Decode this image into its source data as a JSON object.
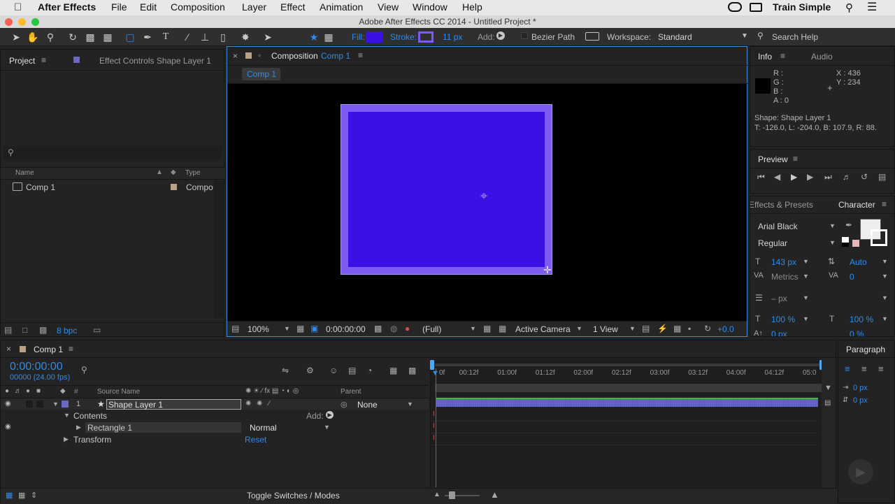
{
  "colors": {
    "accent": "#2d8ceb",
    "shape_fill": "#3a10e5",
    "shape_stroke": "#7d5cf3"
  },
  "menubar": {
    "apple": "",
    "app": "After Effects",
    "items": [
      "File",
      "Edit",
      "Composition",
      "Layer",
      "Effect",
      "Animation",
      "View",
      "Window",
      "Help"
    ],
    "right": "Train Simple"
  },
  "titlebar": {
    "title": "Adobe After Effects CC 2014 - Untitled Project *"
  },
  "toolbar": {
    "fill_label": "Fill:",
    "stroke_label": "Stroke:",
    "stroke_width": "11 px",
    "add_label": "Add:",
    "bezier_label": "Bezier Path",
    "workspace_label": "Workspace:",
    "workspace_value": "Standard",
    "search_placeholder": "Search Help"
  },
  "project": {
    "tab_project": "Project",
    "tab_effect_controls": "Effect Controls Shape Layer 1",
    "col_name": "Name",
    "col_type": "Type",
    "items": [
      {
        "name": "Comp 1",
        "type": "Compo"
      }
    ],
    "bpc": "8 bpc"
  },
  "composition": {
    "tab_prefix": "Composition",
    "tab_name": "Comp 1",
    "breadcrumb": "Comp 1",
    "zoom": "100%",
    "timecode": "0:00:00:00",
    "resolution": "(Full)",
    "camera": "Active Camera",
    "views": "1 View",
    "exposure": "+0.0"
  },
  "info": {
    "tab_info": "Info",
    "tab_audio": "Audio",
    "r": "R :",
    "g": "G :",
    "b": "B :",
    "a": "A : 0",
    "x": "X : 436",
    "y": "Y : 234",
    "shape_line": "Shape: Shape Layer 1",
    "bounds": "T: -126.0, L: -204.0, B: 107.9, R: 88."
  },
  "preview": {
    "title": "Preview"
  },
  "character": {
    "tab_effects": "Effects & Presets",
    "tab_character": "Character",
    "font": "Arial Black",
    "style": "Regular",
    "size": "143 px",
    "leading": "Auto",
    "kerning": "Metrics",
    "tracking": "0",
    "line": "– px",
    "vscale": "100 %",
    "hscale": "100 %",
    "baseline": "0 px",
    "tsume": "0 %"
  },
  "timeline": {
    "tab": "Comp 1",
    "timecode": "0:00:00:00",
    "fps": "00000 (24.00 fps)",
    "col_source": "Source Name",
    "col_parent": "Parent",
    "layer_num": "1",
    "layer_name": "Shape Layer 1",
    "parent_value": "None",
    "contents": "Contents",
    "add_label": "Add:",
    "rect": "Rectangle 1",
    "blend": "Normal",
    "transform": "Transform",
    "reset": "Reset",
    "ruler": [
      "0f",
      "00:12f",
      "01:00f",
      "01:12f",
      "02:00f",
      "02:12f",
      "03:00f",
      "03:12f",
      "04:00f",
      "04:12f",
      "05:0"
    ],
    "toggle": "Toggle Switches / Modes"
  },
  "paragraph": {
    "title": "Paragraph",
    "indent1": "0 px",
    "indent2": "0 px"
  }
}
